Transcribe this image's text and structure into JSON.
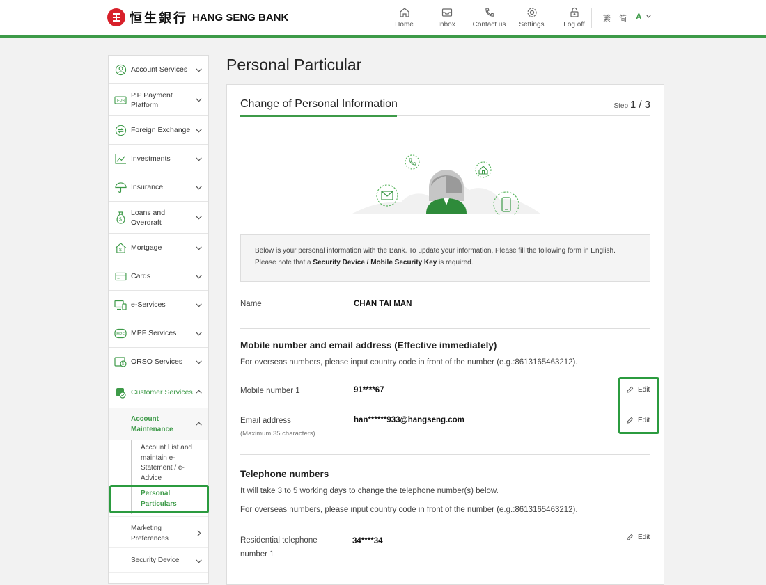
{
  "header": {
    "logo_cn": "恒生銀行",
    "logo_en": "HANG SENG BANK",
    "nav": [
      {
        "label": "Home",
        "icon": "home-icon"
      },
      {
        "label": "Inbox",
        "icon": "inbox-icon"
      },
      {
        "label": "Contact us",
        "icon": "phone-icon"
      },
      {
        "label": "Settings",
        "icon": "gear-icon"
      },
      {
        "label": "Log off",
        "icon": "lock-icon"
      }
    ],
    "lang_trad": "繁",
    "lang_simp": "简",
    "font_size": "A"
  },
  "sidebar": {
    "items": [
      {
        "label": "Account Services"
      },
      {
        "label": "P.P Payment Platform"
      },
      {
        "label": "Foreign Exchange"
      },
      {
        "label": "Investments"
      },
      {
        "label": "Insurance"
      },
      {
        "label": "Loans and Overdraft"
      },
      {
        "label": "Mortgage"
      },
      {
        "label": "Cards"
      },
      {
        "label": "e-Services"
      },
      {
        "label": "MPF Services"
      },
      {
        "label": "ORSO Services"
      },
      {
        "label": "Customer Services"
      }
    ],
    "sub": {
      "account_maintenance": "Account Maintenance",
      "account_list": "Account List and maintain e-Statement / e-Advice",
      "personal_particulars": "Personal Particulars",
      "marketing": "Marketing Preferences",
      "security_device": "Security Device"
    }
  },
  "main": {
    "page_title": "Personal Particular",
    "card_title": "Change of Personal Information",
    "step_label": "Step",
    "step_value": "1 / 3",
    "notice_line1": "Below is your personal information with the Bank. To update your information, Please fill the following form in English.",
    "notice_line2_pre": "Please note that a ",
    "notice_line2_bold": "Security Device / Mobile Security Key",
    "notice_line2_post": " is required.",
    "name_label": "Name",
    "name_value": "CHAN TAI MAN",
    "mobile_section_title": "Mobile number and email address (Effective immediately)",
    "mobile_section_note": "For overseas numbers, please input country code in front of the number (e.g.:8613165463212).",
    "mobile_label": "Mobile number 1",
    "mobile_value": "91****67",
    "email_label": "Email address",
    "email_hint": "(Maximum 35 characters)",
    "email_value": "han******933@hangseng.com",
    "edit_label": "Edit",
    "tel_section_title": "Telephone numbers",
    "tel_note1": "It will take 3 to 5 working days to change the telephone number(s) below.",
    "tel_note2": "For overseas numbers, please input country code in front of the number (e.g.:8613165463212).",
    "res_label_line1": "Residential telephone",
    "res_label_line2": "number 1",
    "res_value": "34****34"
  },
  "colors": {
    "brand_green": "#3d9a48",
    "brand_red": "#d8202a",
    "highlight": "#2b9b3f"
  }
}
